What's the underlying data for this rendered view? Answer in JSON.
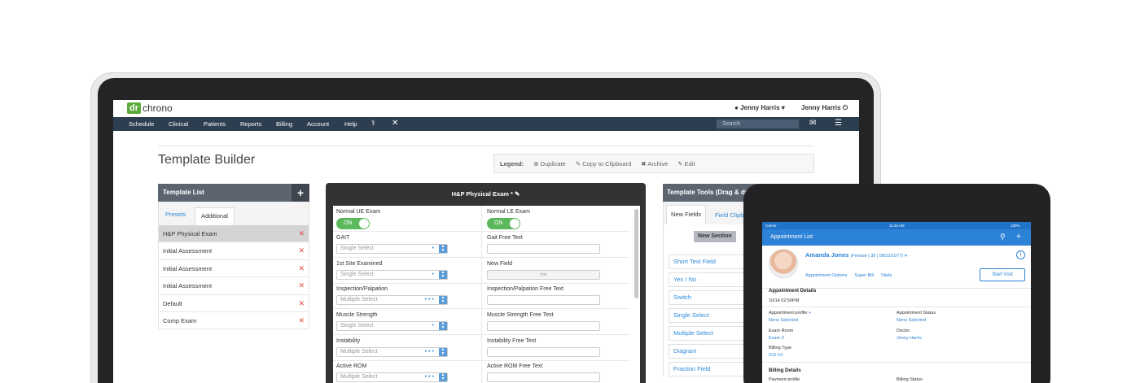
{
  "app": {
    "logo_dr": "dr",
    "logo_chrono": "chrono",
    "user_menu": "Jenny Harris",
    "user_name": "Jenny Harris"
  },
  "nav": {
    "items": [
      "Schedule",
      "Clinical",
      "Patients",
      "Reports",
      "Billing",
      "Account",
      "Help"
    ],
    "search_placeholder": "Search"
  },
  "page": {
    "title": "Template Builder"
  },
  "legend": {
    "label": "Legend:",
    "duplicate": "Duplicate",
    "copy": "Copy to Clipboard",
    "archive": "Archive",
    "edit": "Edit"
  },
  "template_list": {
    "title": "Template List",
    "tabs": [
      "Presets",
      "Additional"
    ],
    "rows": [
      "H&P Physical Exam",
      "Initial Assessment",
      "Initial Assessment",
      "Initial Assessment",
      "Default",
      "Comp Exam"
    ]
  },
  "form": {
    "title": "H&P Physical Exam *",
    "fields": [
      {
        "label": "Normal UE Exam",
        "type": "toggle",
        "value": "ON"
      },
      {
        "label": "Normal LE Exam",
        "type": "toggle",
        "value": "ON"
      },
      {
        "label": "GAIT",
        "type": "select",
        "value": "Single Select"
      },
      {
        "label": "Gait Free Text",
        "type": "text",
        "value": ""
      },
      {
        "label": "1st Site Examined",
        "type": "select",
        "value": "Single Select"
      },
      {
        "label": "New Field",
        "type": "signature",
        "value": ""
      },
      {
        "label": "Inspection/Palpation",
        "type": "select",
        "value": "Multiple Select"
      },
      {
        "label": "Inspection/Palpation Free Text",
        "type": "text",
        "value": ""
      },
      {
        "label": "Muscle Strength",
        "type": "select",
        "value": "Single Select"
      },
      {
        "label": "Muscle Strength Free Text",
        "type": "text",
        "value": ""
      },
      {
        "label": "Instability",
        "type": "select",
        "value": "Multiple Select"
      },
      {
        "label": "Instability Free Text",
        "type": "text",
        "value": ""
      },
      {
        "label": "Active ROM",
        "type": "select",
        "value": "Multiple Select"
      },
      {
        "label": "Active ROM Free Text",
        "type": "text",
        "value": ""
      }
    ]
  },
  "tools": {
    "title": "Template Tools (Drag & drop)",
    "tabs": [
      "New Fields",
      "Field Clipboard"
    ],
    "new_section": "New Section",
    "items": [
      "Short Text Field",
      "Yes / No",
      "Switch",
      "Single Select",
      "Multiple Select",
      "Diagram",
      "Fraction Field"
    ]
  },
  "tablet": {
    "status_carrier": "Carrier",
    "status_time": "11:45 AM",
    "status_battery": "100%",
    "header_title": "Appointment List",
    "patient_name": "Amanda Jones",
    "patient_meta": "(Female | 39 | 08/23/1977)",
    "links": [
      "Appointment Options",
      "Super Bill",
      "Vitals"
    ],
    "start_visit": "Start Visit",
    "appointment_details": "Appointment Details",
    "appointment_time": "10/14 02:50PM",
    "appointment_profile_label": "Appointment profile",
    "appointment_profile_value": "None Selected",
    "appointment_status_label": "Appointment Status",
    "appointment_status_value": "None Selected",
    "exam_room_label": "Exam Room",
    "exam_room_value": "Exam 3",
    "doctor_label": "Doctor",
    "doctor_value": "Jenny Harris",
    "billing_type_label": "Billing Type",
    "billing_type_value": "ICD-10",
    "billing_details": "Billing Details",
    "payment_profile_label": "Payment profile",
    "billing_status_label": "Billing Status"
  },
  "colors": {
    "nav_bg": "#2d3e50",
    "panel_header": "#5c6470",
    "accent_blue": "#2f8ad8",
    "toggle_green": "#5cb85c",
    "delete_red": "#e14b3b",
    "logo_green": "#5aab3a"
  }
}
